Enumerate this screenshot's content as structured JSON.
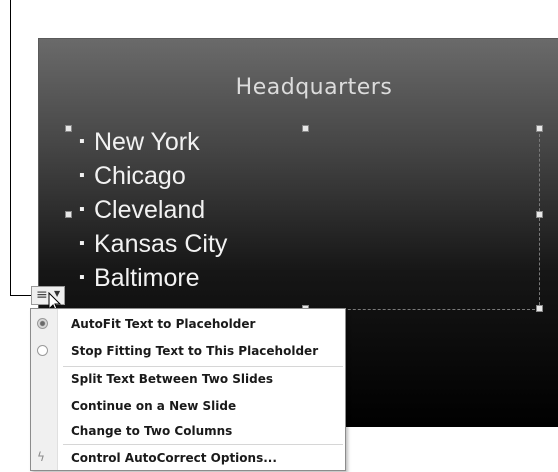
{
  "slide": {
    "title": "Headquarters",
    "bullets": [
      "New York",
      "Chicago",
      "Cleveland",
      "Kansas City",
      "Baltimore"
    ]
  },
  "autofit_button": {
    "icon": "autofit-options-icon",
    "glyph": "≡"
  },
  "menu": {
    "items": [
      {
        "label": "AutoFit Text to Placeholder",
        "icon": "radio-selected-icon"
      },
      {
        "label": "Stop Fitting Text to This Placeholder",
        "icon": "radio-unselected-icon"
      },
      {
        "label": "Split Text Between Two Slides",
        "icon": ""
      },
      {
        "label": "Continue on a New Slide",
        "icon": ""
      },
      {
        "label": "Change to Two Columns",
        "icon": ""
      },
      {
        "label": "Control AutoCorrect Options...",
        "icon": "autocorrect-icon"
      }
    ]
  }
}
